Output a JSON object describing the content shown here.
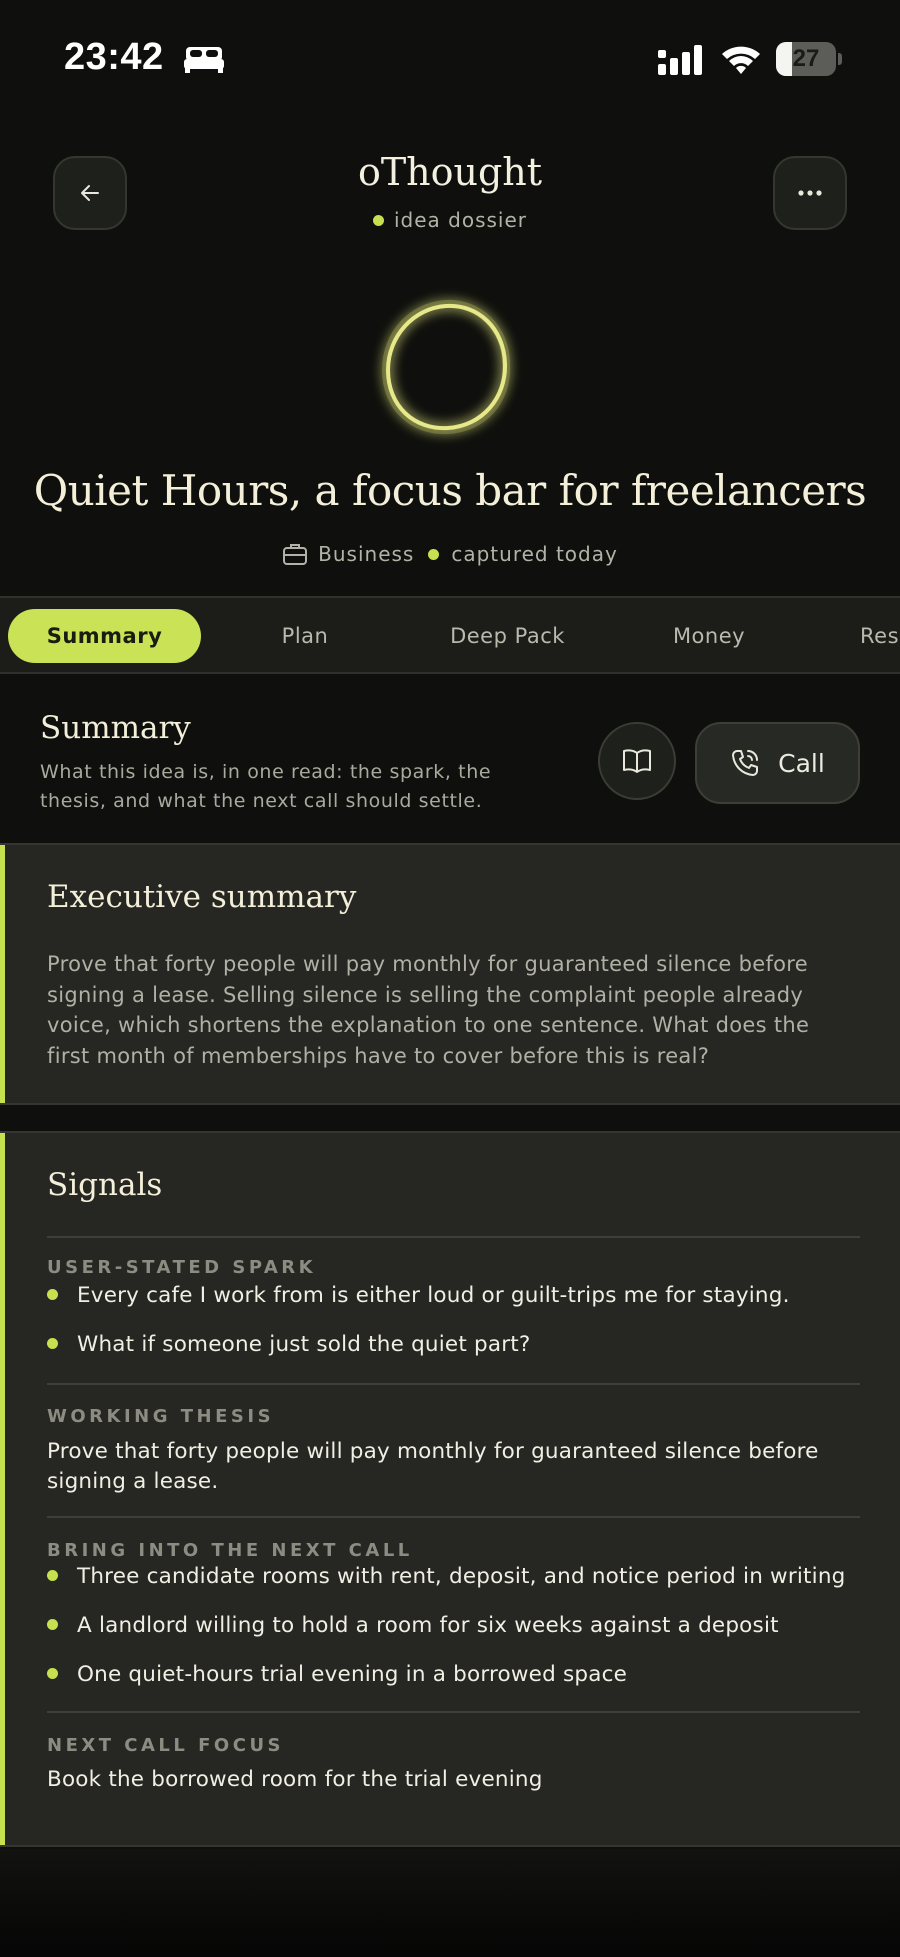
{
  "status_bar": {
    "time": "23:42",
    "battery_level": 27,
    "battery_label": "27"
  },
  "header": {
    "title": "oThought",
    "subtitle": "idea dossier"
  },
  "idea": {
    "title": "Quiet Hours, a focus bar for freelancers",
    "category": "Business",
    "captured": "captured today"
  },
  "tabs": [
    {
      "label": "Summary",
      "active": true
    },
    {
      "label": "Plan"
    },
    {
      "label": "Deep Pack"
    },
    {
      "label": "Money"
    },
    {
      "label": "Res"
    }
  ],
  "section": {
    "title": "Summary",
    "description": "What this idea is, in one read: the spark, the thesis, and what the next call should settle.",
    "call_label": "Call"
  },
  "executive_summary": {
    "title": "Executive summary",
    "text": "Prove that forty people will pay monthly for guaranteed silence before signing a lease. Selling silence is selling the complaint people already voice, which shortens the explanation to one sentence. What does the first month of memberships have to cover before this is real?"
  },
  "signals": {
    "title": "Signals",
    "spark": {
      "label": "USER-STATED SPARK",
      "items": [
        "Every cafe I work from is either loud or guilt-trips me for staying.",
        "What if someone just sold the quiet part?"
      ]
    },
    "thesis": {
      "label": "WORKING THESIS",
      "text": "Prove that forty people will pay monthly for guaranteed silence before signing a lease."
    },
    "next_call": {
      "label": "BRING INTO THE NEXT CALL",
      "items": [
        "Three candidate rooms with rent, deposit, and notice period in writing",
        "A landlord willing to hold a room for six weeks against a deposit",
        "One quiet-hours trial evening in a borrowed space"
      ]
    },
    "focus": {
      "label": "NEXT CALL FOCUS",
      "text": "Book the borrowed room for the trial evening"
    }
  },
  "colors": {
    "accent": "#c7e04f",
    "background": "#0f100d",
    "card": "#262722"
  }
}
